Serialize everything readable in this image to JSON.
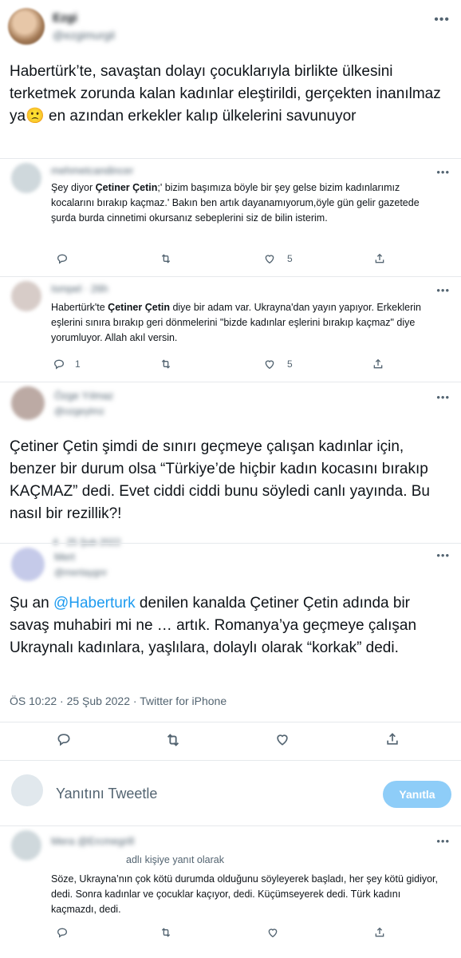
{
  "main_tweet": {
    "name": "Ezgi",
    "handle": "@ezgimurgil",
    "text": "Habertürk’te, savaştan dolayı çocuklarıyla birlikte ülkesini terketmek zorunda kalan kadınlar eleştirildi, gerçekten inanılmaz ya🙁 en azından erkekler kalıp ülkelerini savunuyor"
  },
  "reply1": {
    "name": "mehmetcandincer",
    "pre": "Şey diyor ",
    "bold": "Çetiner Çetin",
    "post": ";' bizim başımıza böyle bir şey gelse bizim kadınlarımız kocalarını bırakıp kaçmaz.' Bakın ben artık dayanamıyorum,öyle gün gelir gazetede şurda burda cinnetimi okursanız sebeplerini siz de bilin isterim.",
    "reply_count": "",
    "like_count": "5"
  },
  "reply2": {
    "name": "Ismpel · 26h",
    "pre": "Habertürk'te ",
    "bold": "Çetiner Çetin",
    "post": " diye bir adam var. Ukrayna'dan yayın yapıyor. Erkeklerin eşlerini sınıra bırakıp geri dönmelerini \"bizde kadınlar eşlerini bırakıp kaçmaz\" diye yorumluyor. Allah akıl versin.",
    "reply_count": "1",
    "like_count": "5"
  },
  "tweet3": {
    "name": "Özge Yılmaz",
    "handle": "@ozgeylmz",
    "text": "Çetiner Çetin şimdi de sınırı geçmeye çalışan kadınlar için, benzer bir durum olsa “Türkiye’de hiçbir kadın kocasını bırakıp KAÇMAZ” dedi. Evet ciddi ciddi bunu söyledi canlı yayında. Bu nasıl bir rezillik?!",
    "date": "4 · 25 Şub 2022"
  },
  "tweet4": {
    "name": "Mert",
    "handle": "@mertaygnr",
    "text_pre": "Şu an ",
    "mention": "@Haberturk",
    "text_post": " denilen kanalda Çetiner Çetin adında bir savaş muhabiri mi ne … artık. Romanya’ya geçmeye çalışan Ukraynalı kadınlara, yaşlılara, dolaylı olarak “korkak” dedi.",
    "meta": "ÖS 10:22 · 25 Şub 2022 · Twitter for iPhone"
  },
  "compose": {
    "placeholder": "Yanıtını Tweetle",
    "button": "Yanıtla"
  },
  "reply_last": {
    "name": "Mera @Ercmegrill",
    "reply_to": "adlı kişiye yanıt olarak",
    "text": "Söze, Ukrayna’nın çok kötü durumda olduğunu söyleyerek başladı, her şey kötü gidiyor, dedi. Sonra kadınlar ve çocuklar kaçıyor, dedi. Küçümseyerek dedi. Türk kadını kaçmazdı, dedi."
  },
  "colors": {
    "accent": "#1d9bf0",
    "text": "#0f1419",
    "muted": "#536471"
  },
  "icons": [
    "more-icon",
    "reply-icon",
    "retweet-icon",
    "like-icon",
    "share-icon"
  ]
}
